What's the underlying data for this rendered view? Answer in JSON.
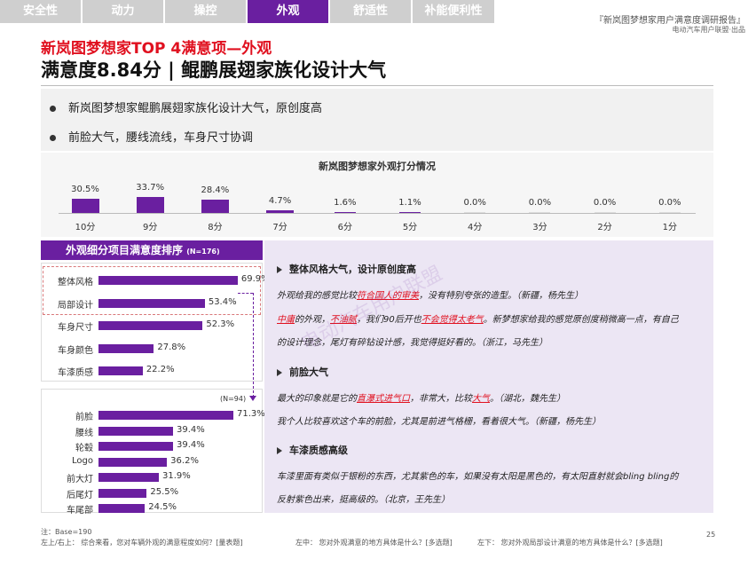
{
  "tabs": [
    {
      "label": "安全性",
      "active": false
    },
    {
      "label": "动力",
      "active": false
    },
    {
      "label": "操控",
      "active": false
    },
    {
      "label": "外观",
      "active": true
    },
    {
      "label": "舒适性",
      "active": false
    },
    {
      "label": "补能便利性",
      "active": false
    }
  ],
  "report": {
    "title": "『新岚图梦想家用户满意度调研报告』",
    "subtitle": "电动汽车用户联盟·出品"
  },
  "headline": {
    "line1": "新岚图梦想家TOP 4满意项—外观",
    "line2": "满意度8.84分 |  鲲鹏展翅家族化设计大气"
  },
  "bullets": [
    "新岚图梦想家鲲鹏展翅家族化设计大气，原创度高",
    "前脸大气，腰线流线，车身尺寸协调"
  ],
  "distribution": {
    "title": "新岚图梦想家外观打分情况",
    "chart_data": {
      "type": "bar",
      "categories": [
        "10分",
        "9分",
        "8分",
        "7分",
        "6分",
        "5分",
        "4分",
        "3分",
        "2分",
        "1分"
      ],
      "values": [
        30.5,
        33.7,
        28.4,
        4.7,
        1.6,
        1.1,
        0.0,
        0.0,
        0.0,
        0.0
      ],
      "value_labels": [
        "30.5%",
        "33.7%",
        "28.4%",
        "4.7%",
        "1.6%",
        "1.1%",
        "0.0%",
        "0.0%",
        "0.0%",
        "0.0%"
      ]
    }
  },
  "ranking": {
    "title": "外观细分项目满意度排序",
    "n": "(N=176)",
    "chart_data": {
      "type": "bar",
      "categories": [
        "整体风格",
        "局部设计",
        "车身尺寸",
        "车身颜色",
        "车漆质感"
      ],
      "values": [
        69.9,
        53.4,
        52.3,
        27.8,
        22.2
      ],
      "value_labels": [
        "69.9%",
        "53.4%",
        "52.3%",
        "27.8%",
        "22.2%"
      ]
    },
    "sub": {
      "n": "(N=94)",
      "chart_data": {
        "type": "bar",
        "categories": [
          "前脸",
          "腰线",
          "轮毂",
          "Logo",
          "前大灯",
          "后尾灯",
          "车尾部"
        ],
        "values": [
          71.3,
          39.4,
          39.4,
          36.2,
          31.9,
          25.5,
          24.5
        ],
        "value_labels": [
          "71.3%",
          "39.4%",
          "39.4%",
          "36.2%",
          "31.9%",
          "25.5%",
          "24.5%"
        ]
      }
    }
  },
  "quotes": {
    "s1": {
      "head": "整体风格大气，设计原创度高",
      "l1a": "外观给我的感觉比较",
      "l1r": "符合国人的审美",
      "l1b": "，没有特别夸张的造型。（新疆，杨先生）",
      "l2r1": "中庸",
      "l2a": "的外观，",
      "l2r2": "不油腻",
      "l2b": "，我们90后开也",
      "l2r3": "不会觉得太老气",
      "l2c": "。新梦想家给我的感觉原创度稍微高一点，有自己",
      "l3": "的设计理念，尾灯有碎钻设计感，我觉得挺好看的。（浙江，马先生）"
    },
    "s2": {
      "head": "前脸大气",
      "l1a": "最大的印象就是它的",
      "l1r": "直瀑式进气口",
      "l1b": "，非常大，比较",
      "l1r2": "大气",
      "l1c": "。（湖北，魏先生）",
      "l2": "我个人比较喜欢这个车的前脸，尤其是前进气格栅，看着很大气。（新疆，杨先生）"
    },
    "s3": {
      "head": "车漆质感高级",
      "l1": "车漆里面有类似于银粉的东西，尤其紫色的车，如果没有太阳是黑色的，有太阳直射就会bling bling的",
      "l2": "反射紫色出来，挺高级的。（北京，王先生）"
    }
  },
  "watermark": "电动汽车用户联盟",
  "footnotes": {
    "f1": "注：Base=190",
    "f2": "左上/右上：  综合来看，您对车辆外观的满意程度如何？[量表题]",
    "f3": "左中：  您对外观满意的地方具体是什么？[多选题]",
    "f4": "左下：  您对外观局部设计满意的地方具体是什么？[多选题]"
  },
  "page_number": "25",
  "colors": {
    "accent": "#6a1fa0",
    "red": "#e0101f"
  }
}
